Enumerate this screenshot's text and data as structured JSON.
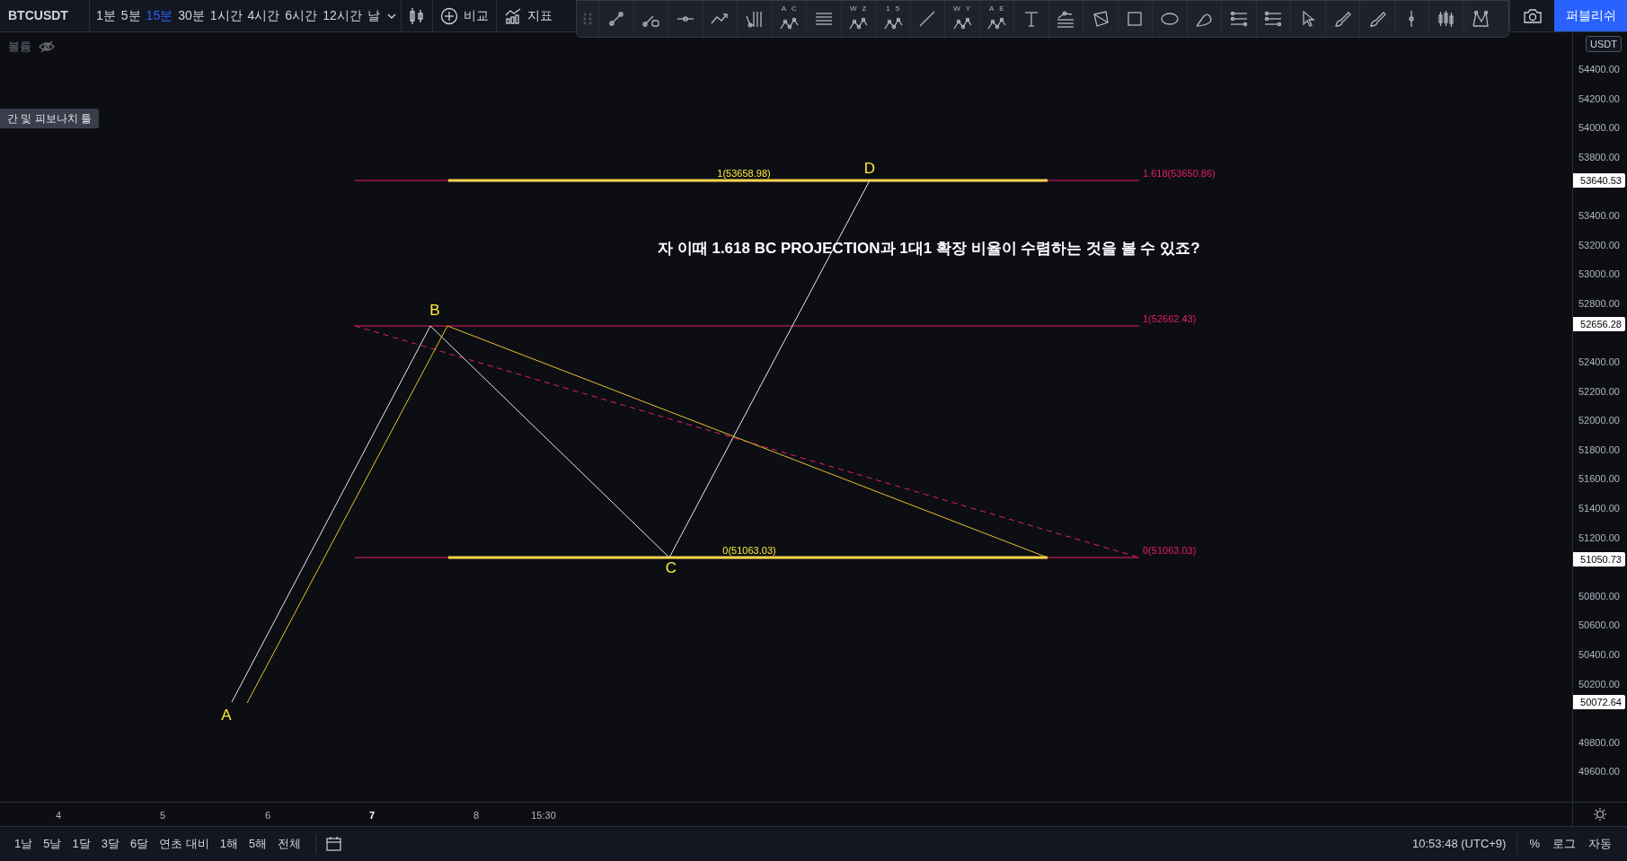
{
  "symbol": "BTCUSDT",
  "intervals": [
    {
      "label": "1분",
      "selected": false
    },
    {
      "label": "5분",
      "selected": false
    },
    {
      "label": "15분",
      "selected": true
    },
    {
      "label": "30분",
      "selected": false
    },
    {
      "label": "1시간",
      "selected": false
    },
    {
      "label": "4시간",
      "selected": false
    },
    {
      "label": "6시간",
      "selected": false
    },
    {
      "label": "12시간",
      "selected": false
    },
    {
      "label": "날",
      "selected": false
    }
  ],
  "compare_button": "비교",
  "indicators_button": "지표",
  "drawing_toolbar": [
    {
      "kind": "trend"
    },
    {
      "kind": "ray"
    },
    {
      "kind": "hline"
    },
    {
      "kind": "arrow"
    },
    {
      "kind": "vlines"
    },
    {
      "kind": "pattern",
      "letters": [
        "A",
        "C"
      ]
    },
    {
      "kind": "hlines"
    },
    {
      "kind": "pattern",
      "letters": [
        "W",
        "Z"
      ]
    },
    {
      "kind": "pattern",
      "letters": [
        "1",
        "5"
      ]
    },
    {
      "kind": "line"
    },
    {
      "kind": "pattern",
      "letters": [
        "W",
        "Y"
      ]
    },
    {
      "kind": "pattern",
      "letters": [
        "A",
        "E"
      ]
    },
    {
      "kind": "text"
    },
    {
      "kind": "fib"
    },
    {
      "kind": "polygon"
    },
    {
      "kind": "rect"
    },
    {
      "kind": "ellipse"
    },
    {
      "kind": "arc"
    },
    {
      "kind": "list"
    },
    {
      "kind": "list"
    },
    {
      "kind": "cursor"
    },
    {
      "kind": "brush"
    },
    {
      "kind": "brush"
    },
    {
      "kind": "vline"
    },
    {
      "kind": "bars"
    },
    {
      "kind": "xabcd"
    }
  ],
  "publish_button": "퍼블리쉬",
  "legend": {
    "label": "볼륨",
    "visible": false
  },
  "tooltip": "간 및 피보나치 툴",
  "chart": {
    "annotation": "자 이때 1.618 BC PROJECTION과 1대1 확장 비율이 수렴하는 것을 볼 수 있죠?",
    "points": [
      {
        "label": "A"
      },
      {
        "label": "B"
      },
      {
        "label": "C"
      },
      {
        "label": "D"
      }
    ],
    "level_labels": [
      {
        "kind": "projection",
        "text": "1(53658.98)"
      },
      {
        "kind": "fib",
        "text": "1.618(53650.86)"
      },
      {
        "kind": "fib",
        "text": "1(52662.43)"
      },
      {
        "kind": "projection",
        "text": "0(51063.03)"
      },
      {
        "kind": "fib",
        "text": "0(51063.03)"
      }
    ]
  },
  "price_axis": {
    "currency": "USDT",
    "ticks": [
      "54400.00",
      "54200.00",
      "54000.00",
      "53800.00",
      "53400.00",
      "53200.00",
      "53000.00",
      "52800.00",
      "52400.00",
      "52200.00",
      "52000.00",
      "51800.00",
      "51600.00",
      "51400.00",
      "51200.00",
      "50800.00",
      "50600.00",
      "50400.00",
      "50200.00",
      "49800.00",
      "49600.00"
    ],
    "markers": [
      "53640.53",
      "52656.28",
      "51050.73",
      "50072.64"
    ]
  },
  "time_axis": [
    {
      "label": "4",
      "bold": false
    },
    {
      "label": "5",
      "bold": false
    },
    {
      "label": "6",
      "bold": false
    },
    {
      "label": "7",
      "bold": true
    },
    {
      "label": "8",
      "bold": false
    },
    {
      "label": "15:30",
      "bold": false
    }
  ],
  "range_buttons": [
    "1날",
    "5날",
    "1달",
    "3달",
    "6달",
    "연초 대비",
    "1해",
    "5해",
    "전체"
  ],
  "clock": "10:53:48 (UTC+9)",
  "scale_options": [
    "%",
    "로그",
    "자동"
  ]
}
